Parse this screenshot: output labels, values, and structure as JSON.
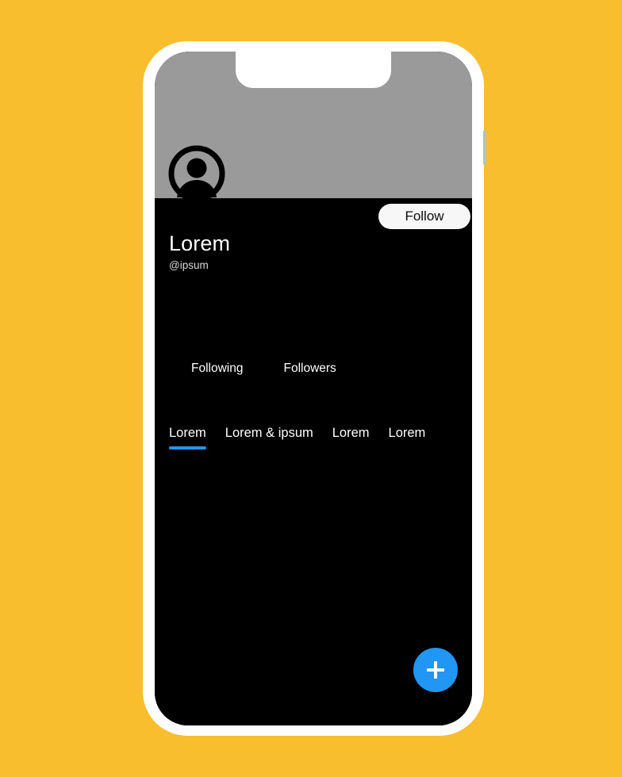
{
  "background": {
    "color": "#f8be2d"
  },
  "device": {
    "frame_color": "#ffffff",
    "screen_color": "#000000",
    "side_button": "side-button"
  },
  "screen": {
    "cover_photo": {
      "color": "#9a9a9a",
      "label": "cover-photo"
    },
    "notch": {
      "color": "#ffffff"
    },
    "avatar": {
      "icon": "user-avatar-icon",
      "ring_color": "#000000",
      "fill_color": "#9a9a9a"
    },
    "profile": {
      "display_name": "Lorem",
      "handle": "@ipsum",
      "follow_button": {
        "label": "Follow",
        "bg_color": "#f7f7f7",
        "text_color": "#0c0c0c"
      }
    },
    "stats": [
      {
        "label": "Following"
      },
      {
        "label": "Followers"
      }
    ],
    "tabs": [
      {
        "label": "Lorem",
        "active": true
      },
      {
        "label": "Lorem & ipsum",
        "active": false
      },
      {
        "label": "Lorem",
        "active": false
      },
      {
        "label": "Lorem",
        "active": false
      }
    ],
    "accent_color": "#2196f3",
    "fab": {
      "icon": "plus-icon",
      "color": "#2196f3",
      "icon_color": "#ffffff"
    }
  }
}
